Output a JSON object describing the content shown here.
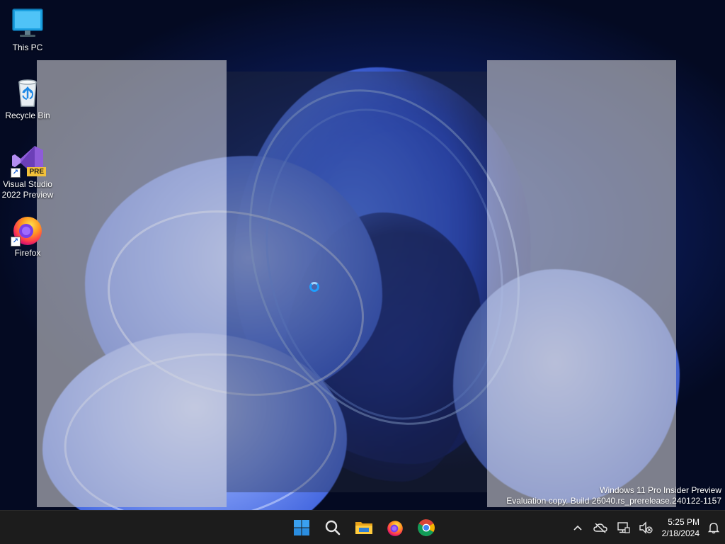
{
  "desktop": {
    "icons": [
      {
        "label": "This PC",
        "icon": "this-pc-icon"
      },
      {
        "label": "Recycle Bin",
        "icon": "recycle-bin-icon"
      },
      {
        "label": "Visual Studio 2022 Preview",
        "icon": "visual-studio-icon",
        "badge": "PRE",
        "shortcut": true
      },
      {
        "label": "Firefox",
        "icon": "firefox-icon",
        "shortcut": true
      }
    ]
  },
  "watermark": {
    "line1": "Windows 11 Pro Insider Preview",
    "line2": "Evaluation copy. Build 26040.rs_prerelease.240122-1157"
  },
  "taskbar": {
    "apps": [
      {
        "name": "start-button",
        "icon": "windows-logo-icon"
      },
      {
        "name": "search-button",
        "icon": "search-icon"
      },
      {
        "name": "file-explorer-button",
        "icon": "folder-icon"
      },
      {
        "name": "firefox-taskbar-button",
        "icon": "firefox-icon"
      },
      {
        "name": "chrome-taskbar-button",
        "icon": "chrome-icon"
      }
    ],
    "tray": {
      "icons": [
        "chevron-up-icon",
        "onedrive-offline-icon",
        "network-icon",
        "volume-muted-icon"
      ],
      "time": "5:25 PM",
      "date": "2/18/2024",
      "notification_icon": "bell-icon"
    }
  },
  "colors": {
    "taskbar_bg": "#1c1c1c",
    "accent": "#0078d4",
    "snap_zone": "#c8c8cd"
  }
}
